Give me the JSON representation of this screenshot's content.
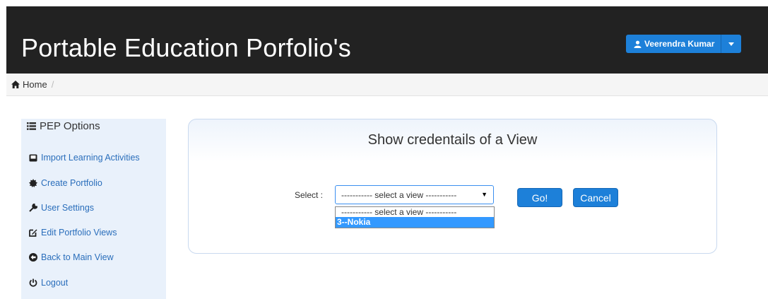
{
  "header": {
    "brand": "Portable Education Porfolio's",
    "user_name": "Veerendra Kumar"
  },
  "breadcrumb": {
    "home_label": "Home",
    "separator": "/"
  },
  "sidebar": {
    "title": "PEP Options",
    "items": [
      {
        "label": "Import Learning Activities",
        "icon": "hdd-icon"
      },
      {
        "label": "Create Portfolio",
        "icon": "certificate-icon"
      },
      {
        "label": "User Settings",
        "icon": "wrench-icon"
      },
      {
        "label": "Edit Portfolio Views",
        "icon": "edit-icon"
      },
      {
        "label": "Back to Main View",
        "icon": "circle-arrow-left-icon"
      },
      {
        "label": "Logout",
        "icon": "power-icon"
      }
    ]
  },
  "panel": {
    "title": "Show credentails of a View",
    "select_label": "Select :",
    "select_value": "----------- select a view -----------",
    "options": [
      "----------- select a view -----------",
      "3--Nokia"
    ],
    "go_label": "Go!",
    "cancel_label": "Cancel"
  },
  "colors": {
    "navbar": "#222222",
    "primary": "#1d80d9",
    "sidebar_bg": "#e9f1fb",
    "link": "#2a6ebb",
    "option_highlight": "#3399ff"
  }
}
